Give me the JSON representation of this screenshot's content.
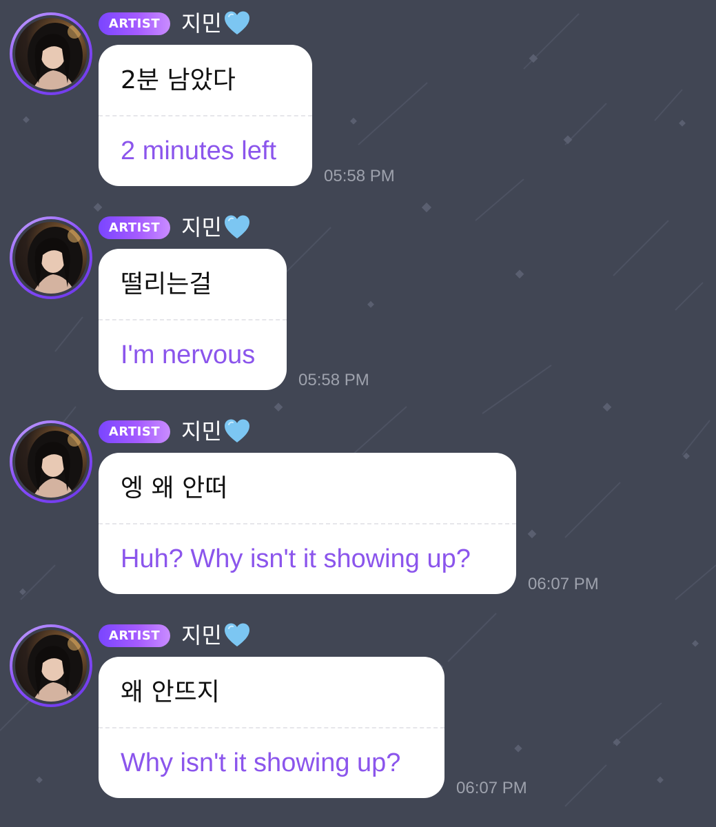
{
  "colors": {
    "background": "#414654",
    "bubble": "#ffffff",
    "original_text": "#111111",
    "translation_text": "#8b55ec",
    "timestamp": "#9ea2ad",
    "badge_gradient_start": "#7a45ff",
    "badge_gradient_end": "#c98cff",
    "heart": "#7cc6f2"
  },
  "messages": [
    {
      "badge": "ARTIST",
      "sender": "지민",
      "sender_emoji": "light-blue-heart-icon",
      "original": "2분 남았다",
      "translation": "2 minutes left",
      "time": "05:58 PM"
    },
    {
      "badge": "ARTIST",
      "sender": "지민",
      "sender_emoji": "light-blue-heart-icon",
      "original": "떨리는걸",
      "translation": "I'm nervous",
      "time": "05:58 PM"
    },
    {
      "badge": "ARTIST",
      "sender": "지민",
      "sender_emoji": "light-blue-heart-icon",
      "original": "엥 왜 안떠",
      "translation": "Huh? Why isn't it showing up?",
      "time": "06:07 PM"
    },
    {
      "badge": "ARTIST",
      "sender": "지민",
      "sender_emoji": "light-blue-heart-icon",
      "original": "왜 안뜨지",
      "translation": "Why isn't it showing up?",
      "time": "06:07 PM"
    }
  ]
}
